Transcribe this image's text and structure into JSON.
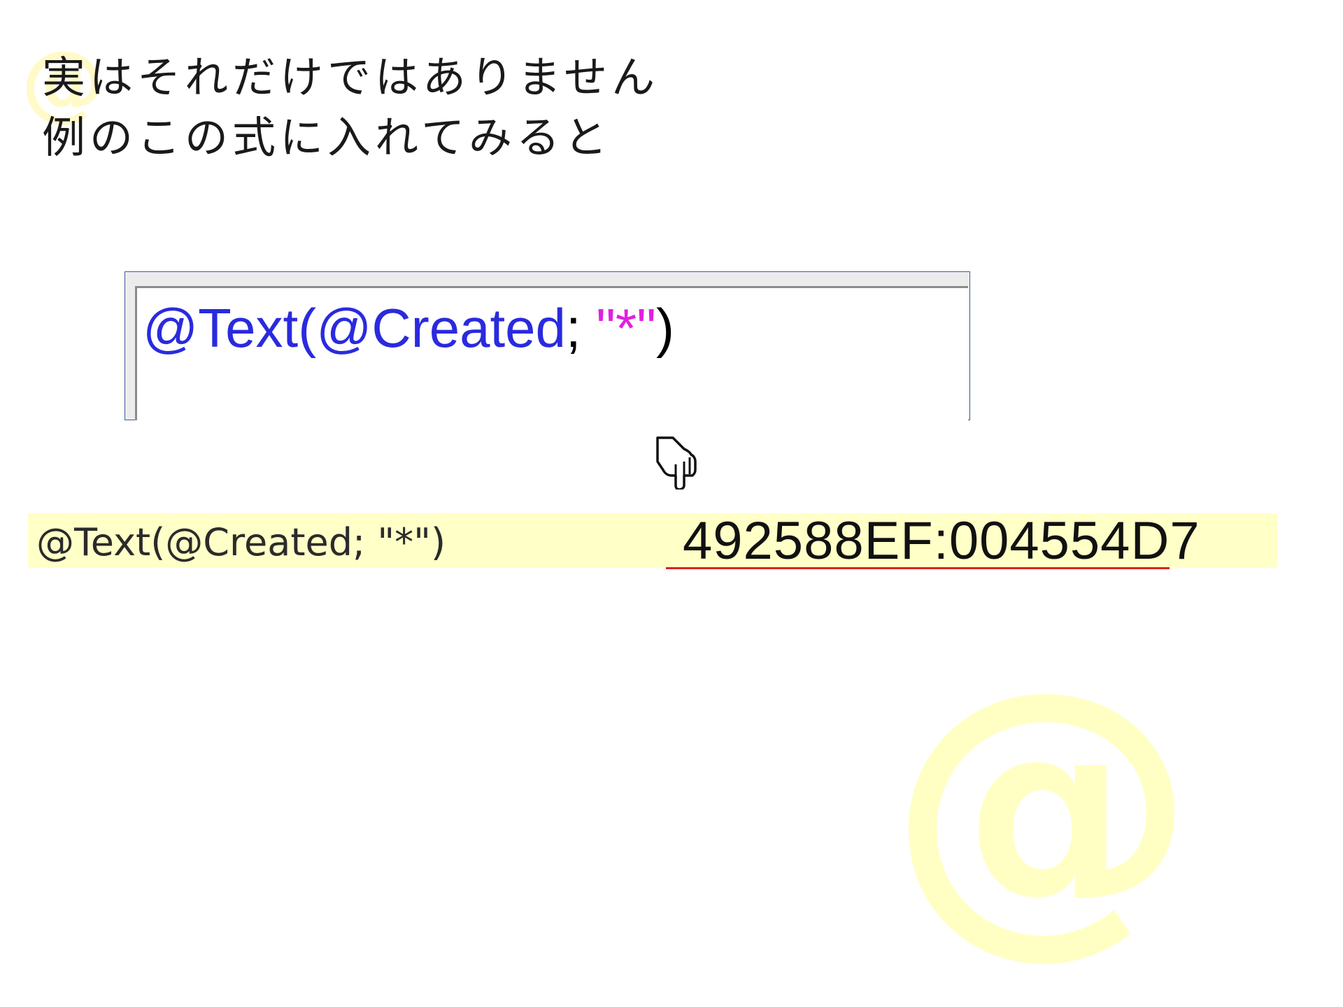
{
  "heading": {
    "line1": "実はそれだけではありません",
    "line2": "例のこの式に入れてみると"
  },
  "formula_editor": {
    "fn_part1": "@Text(@Created",
    "separator": "; ",
    "string_literal": "\"*\"",
    "close_paren": ")"
  },
  "result": {
    "formula_text": "@Text(@Created; \"*\")",
    "value": "492588EF:004554D7"
  },
  "watermarks": {
    "small": "@",
    "large": "@"
  },
  "colors": {
    "function_blue": "#2a2adf",
    "string_magenta": "#e020e0",
    "highlight_yellow": "#ffffc8",
    "underline_red": "#e02020",
    "watermark_yellow": "#ffffc4"
  },
  "icons": {
    "pointer": "pointing-hand-down-icon"
  }
}
